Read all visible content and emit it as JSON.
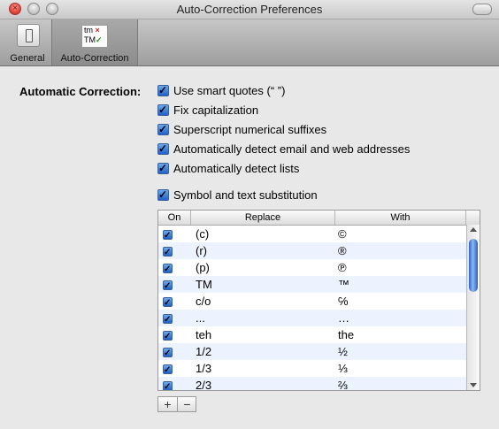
{
  "window": {
    "title": "Auto-Correction Preferences",
    "close_glyph": "×"
  },
  "toolbar": {
    "items": [
      {
        "label": "General",
        "icon": "switch-icon"
      },
      {
        "label": "Auto-Correction",
        "icon": "autocorrect-icon",
        "selected": true
      }
    ],
    "autocorr_icon": {
      "line1": "tm",
      "x": "×",
      "line2": "TM",
      "check": "✓"
    }
  },
  "section": {
    "label": "Automatic Correction:"
  },
  "options": [
    {
      "label": "Use smart quotes (“ ”)",
      "checked": true
    },
    {
      "label": "Fix capitalization",
      "checked": true
    },
    {
      "label": "Superscript numerical suffixes",
      "checked": true
    },
    {
      "label": "Automatically detect email and web addresses",
      "checked": true
    },
    {
      "label": "Automatically detect lists",
      "checked": true
    },
    {
      "label": "Symbol and text substitution",
      "checked": true
    }
  ],
  "table": {
    "headers": {
      "on": "On",
      "replace": "Replace",
      "with": "With"
    },
    "rows": [
      {
        "on": true,
        "replace": "(c)",
        "with": "©"
      },
      {
        "on": true,
        "replace": "(r)",
        "with": "®"
      },
      {
        "on": true,
        "replace": "(p)",
        "with": "℗"
      },
      {
        "on": true,
        "replace": "TM",
        "with": "™"
      },
      {
        "on": true,
        "replace": "c/o",
        "with": "℅"
      },
      {
        "on": true,
        "replace": "...",
        "with": "…"
      },
      {
        "on": true,
        "replace": "teh",
        "with": "the"
      },
      {
        "on": true,
        "replace": "1/2",
        "with": "½"
      },
      {
        "on": true,
        "replace": "1/3",
        "with": "⅓"
      },
      {
        "on": true,
        "replace": "2/3",
        "with": "⅔"
      }
    ]
  },
  "buttons": {
    "add": "+",
    "remove": "−"
  }
}
